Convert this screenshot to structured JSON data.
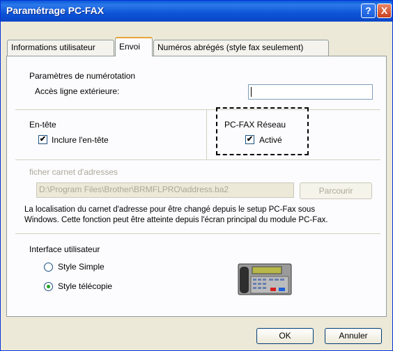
{
  "window": {
    "title": "Paramétrage PC-FAX",
    "help_glyph": "?",
    "close_glyph": "X"
  },
  "tabs": [
    {
      "label": "Informations utilisateur",
      "active": false
    },
    {
      "label": "Envoi",
      "active": true
    },
    {
      "label": "Numéros abrégés (style fax seulement)",
      "active": false
    }
  ],
  "dialing": {
    "title": "Paramètres de numérotation",
    "outside_line_label": "Accès ligne extérieure:",
    "outside_line_value": ""
  },
  "header": {
    "title": "En-tête",
    "include_label": "Inclure l'en-tête",
    "include_checked": true
  },
  "network": {
    "title": "PC-FAX Réseau",
    "active_label": "Activé",
    "active_checked": true
  },
  "address_book": {
    "title": "ficher carnet d'adresses",
    "path_value": "D:\\Program Files\\Brother\\BRMFLPRO\\address.ba2",
    "browse_label": "Parcourir",
    "info_line1": "La localisation du carnet d'adresse pour être changé depuis le setup PC-Fax sous",
    "info_line2": "Windows. Cette fonction peut être atteinte depuis l'écran principal du module PC-Fax."
  },
  "ui": {
    "title": "Interface utilisateur",
    "option_simple": "Style Simple",
    "option_fax": "Style télécopie",
    "selected": "Style télécopie"
  },
  "icons": {
    "fax_machine": "fax-machine-icon",
    "checkmark": "✔"
  },
  "buttons": {
    "ok_label": "OK",
    "cancel_label": "Annuler"
  }
}
